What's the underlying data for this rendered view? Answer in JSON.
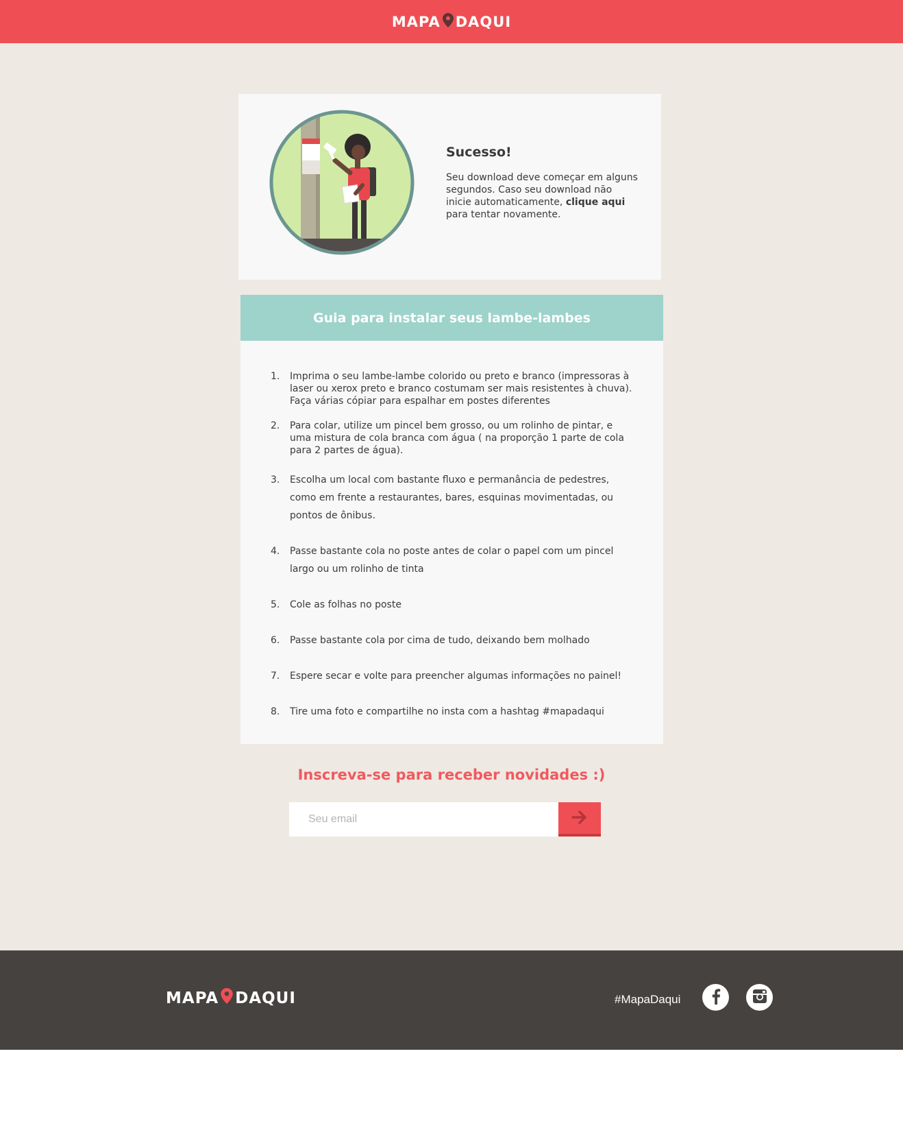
{
  "header": {
    "logo_left": "MAPA",
    "logo_right": "DAQUI"
  },
  "success": {
    "title": "Sucesso!",
    "text_before": "Seu download deve começar em alguns segundos. Caso seu download não inicie automaticamente, ",
    "link_text": "clique aqui",
    "text_after": " para tentar novamente."
  },
  "guide": {
    "title": "Guia para instalar seus lambe-lambes",
    "steps": [
      {
        "num": "1.",
        "text": "Imprima o seu lambe-lambe colorido ou preto e branco (impressoras à laser ou xerox preto e branco costumam ser mais resistentes à chuva). Faça várias cópiar para espalhar em postes diferentes"
      },
      {
        "num": "2.",
        "text": "Para colar, utilize um pincel bem grosso, ou um rolinho de pintar, e uma mistura de cola branca com água ( na proporção 1 parte de cola para 2 partes de água)."
      },
      {
        "num": "3.",
        "text": "Escolha um local com bastante fluxo e permanância de pedestres, como em frente a restaurantes, bares, esquinas movimentadas, ou pontos de ônibus."
      },
      {
        "num": "4.",
        "text": "Passe bastante cola no poste antes de colar o papel com um pincel largo ou um rolinho de tinta"
      },
      {
        "num": "5.",
        "text": "Cole as folhas no poste"
      },
      {
        "num": "6.",
        "text": "Passe bastante cola por cima de tudo, deixando bem molhado"
      },
      {
        "num": "7.",
        "text": "Espere secar e volte para preencher algumas informações no painel!"
      },
      {
        "num": "8.",
        "text": "Tire uma foto e compartilhe no insta com a hashtag #mapadaqui"
      }
    ]
  },
  "newsletter": {
    "title": "Inscreva-se para receber novidades :)",
    "placeholder": "Seu email",
    "submit_icon": "arrow-right-icon"
  },
  "footer": {
    "logo_left": "MAPA",
    "logo_right": "DAQUI",
    "hashtag": "#MapaDaqui",
    "social": [
      "facebook-icon",
      "instagram-icon"
    ]
  },
  "colors": {
    "brand_red": "#ef4f54",
    "teal": "#9dd3cb",
    "page_bg": "#efe9e3",
    "footer_bg": "#46423f"
  }
}
